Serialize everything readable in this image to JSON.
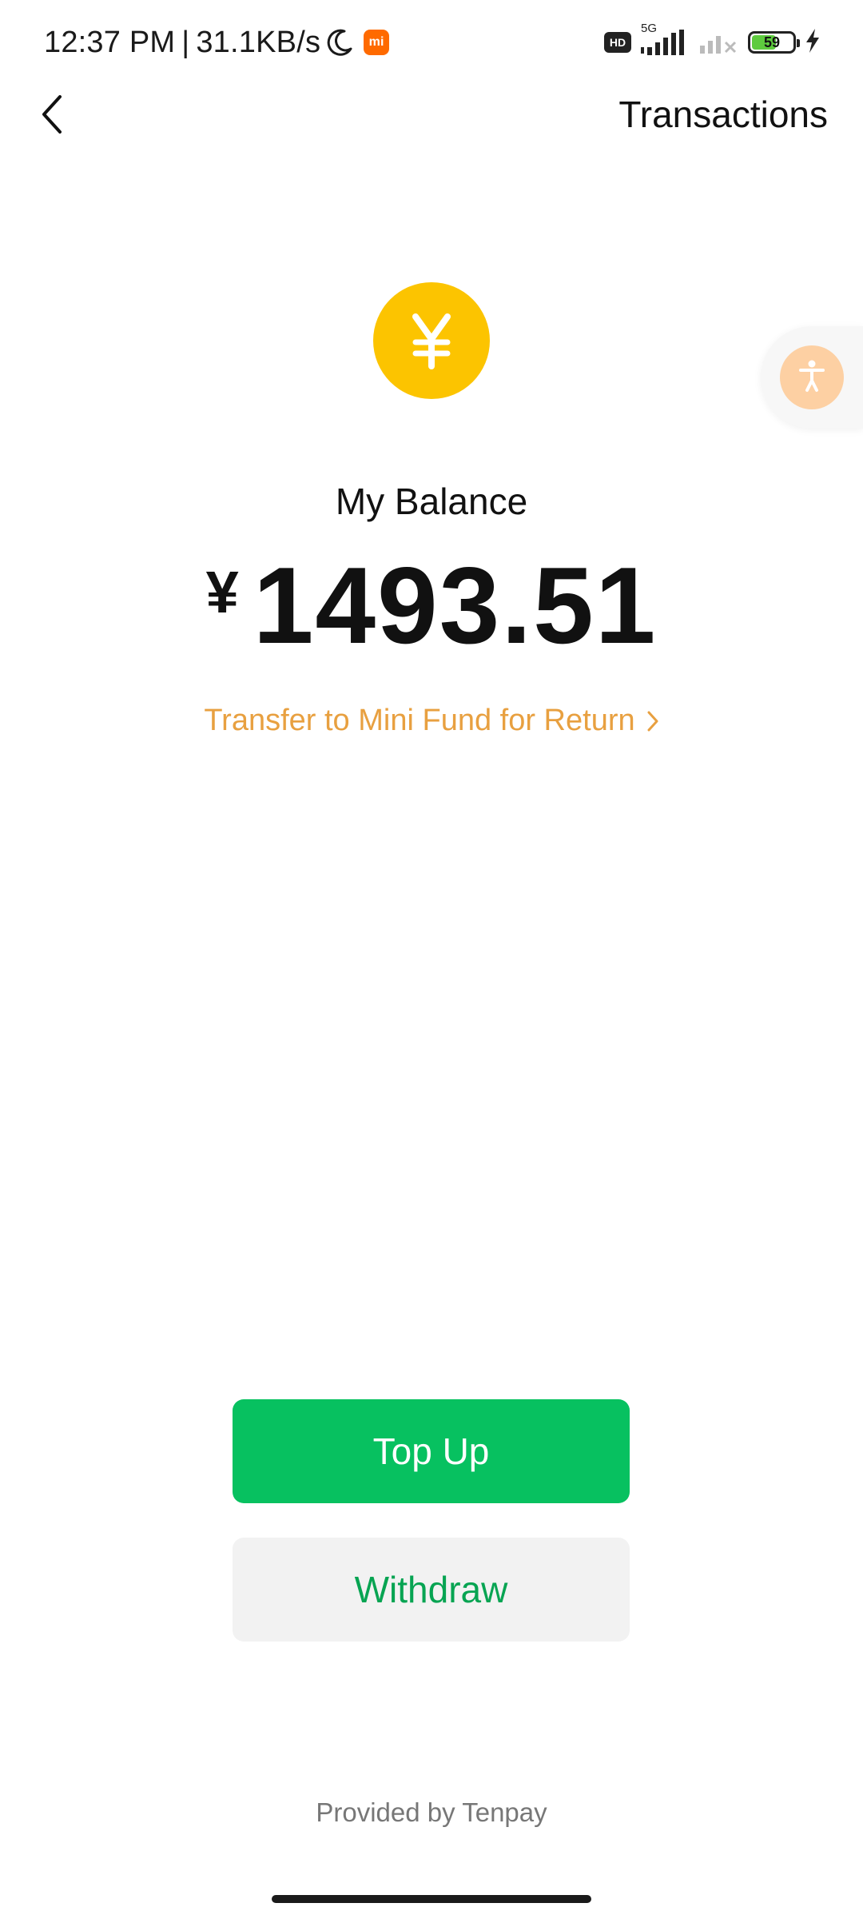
{
  "status_bar": {
    "time": "12:37 PM",
    "separator": "|",
    "speed": "31.1KB/s",
    "brand_badge": "mi",
    "hd_badge": "HD",
    "network": "5G",
    "battery_level": "59",
    "battery_fraction": 0.59
  },
  "nav": {
    "back_icon": "chevron-left-icon",
    "title": "Transactions"
  },
  "balance": {
    "coin_symbol": "¥",
    "label": "My Balance",
    "currency": "¥",
    "amount": "1493.51",
    "fund_link": "Transfer to Mini Fund for Return"
  },
  "float_button": {
    "icon": "accessibility-icon"
  },
  "actions": {
    "top_up": "Top Up",
    "withdraw": "Withdraw"
  },
  "footer": {
    "provider": "Provided by Tenpay"
  },
  "colors": {
    "coin": "#fcc400",
    "primary_green": "#07c160",
    "link_orange": "#e8a040",
    "withdraw_bg": "#f2f2f2"
  }
}
